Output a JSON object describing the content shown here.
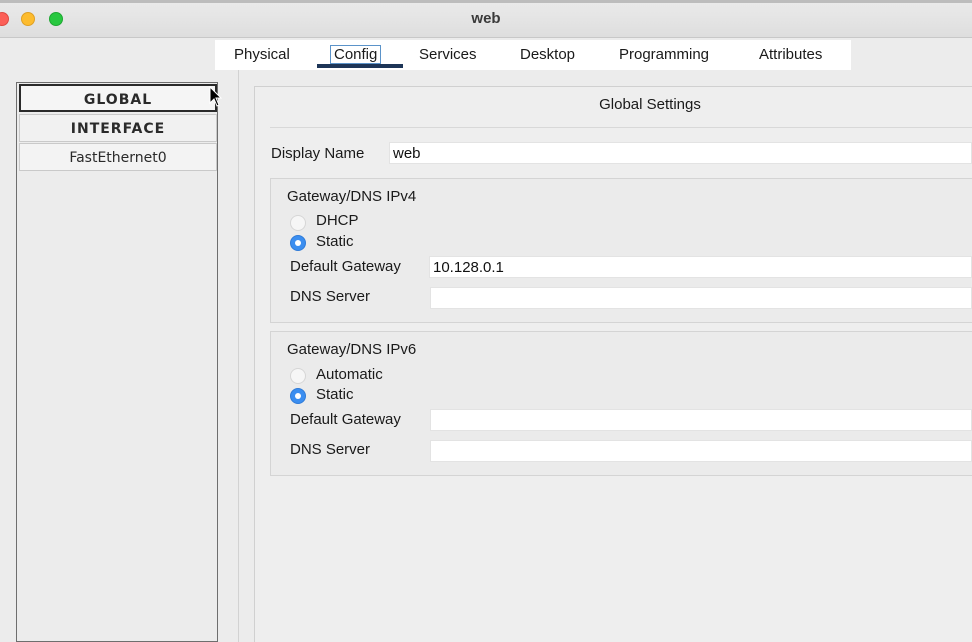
{
  "window": {
    "title": "web"
  },
  "tabs": [
    {
      "label": "Physical"
    },
    {
      "label": "Config",
      "active": true
    },
    {
      "label": "Services"
    },
    {
      "label": "Desktop"
    },
    {
      "label": "Programming"
    },
    {
      "label": "Attributes"
    }
  ],
  "sidebar": {
    "items": [
      {
        "label": "GLOBAL",
        "selected": true
      },
      {
        "label": "INTERFACE"
      },
      {
        "label": "FastEthernet0"
      }
    ]
  },
  "main": {
    "title": "Global Settings",
    "display_name_label": "Display Name",
    "display_name_value": "web",
    "ipv4": {
      "title": "Gateway/DNS IPv4",
      "option_dhcp": "DHCP",
      "option_static": "Static",
      "selected": "Static",
      "gateway_label": "Default Gateway",
      "gateway_value": "10.128.0.1",
      "dns_label": "DNS Server",
      "dns_value": ""
    },
    "ipv6": {
      "title": "Gateway/DNS IPv6",
      "option_auto": "Automatic",
      "option_static": "Static",
      "selected": "Static",
      "gateway_label": "Default Gateway",
      "gateway_value": "",
      "dns_label": "DNS Server",
      "dns_value": ""
    }
  },
  "colors": {
    "accent": "#3b8ef0",
    "tab_underline": "#1d3557"
  }
}
